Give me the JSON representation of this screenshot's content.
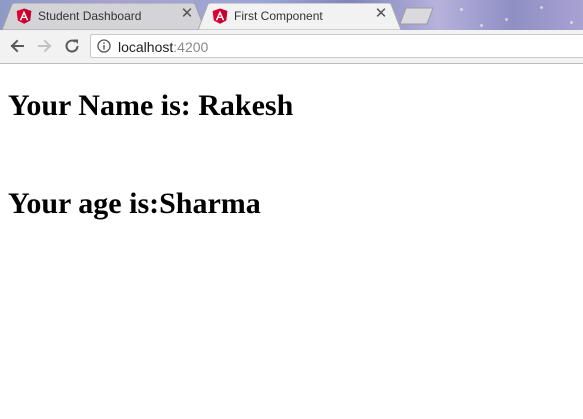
{
  "browser": {
    "tabs": [
      {
        "title": "Student Dashboard",
        "active": false,
        "icon": "angular-logo-icon"
      },
      {
        "title": "First Component",
        "active": true,
        "icon": "angular-logo-icon"
      }
    ],
    "address_host": "localhost",
    "address_port": ":4200",
    "colors": {
      "angular_red": "#dd0031",
      "toolbar": "#f2f2f2"
    }
  },
  "page": {
    "name_label": "Your Name is: Rakesh",
    "age_label": "Your age is:Sharma"
  }
}
